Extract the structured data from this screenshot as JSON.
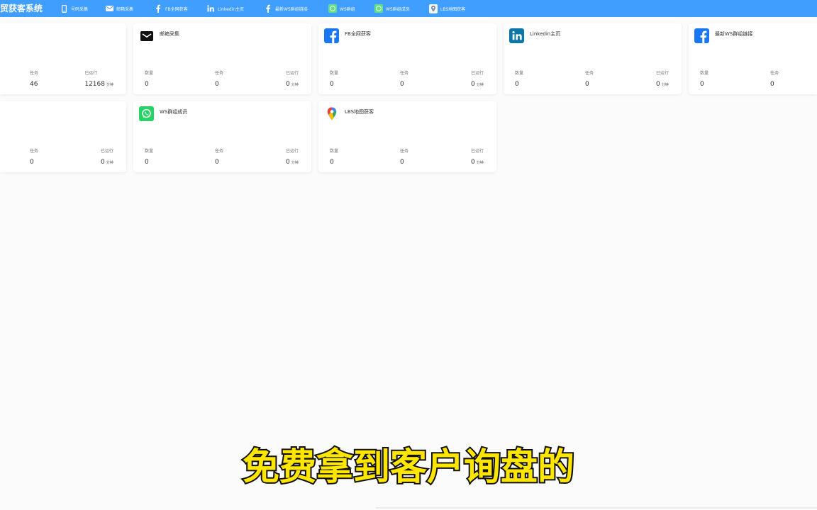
{
  "app": {
    "title": "贸获客系统"
  },
  "nav": {
    "items": [
      {
        "label": "号码采集",
        "icon": "phone-icon"
      },
      {
        "label": "邮箱采集",
        "icon": "envelope-icon"
      },
      {
        "label": "FB全网获客",
        "icon": "facebook-icon"
      },
      {
        "label": "Linkedin主页",
        "icon": "linkedin-icon"
      },
      {
        "label": "最新WS群组链接",
        "icon": "facebook-icon"
      },
      {
        "label": "WS群组",
        "icon": "whatsapp-icon"
      },
      {
        "label": "WS群组成员",
        "icon": "whatsapp-icon"
      },
      {
        "label": "LBS地图获客",
        "icon": "map-pin-icon"
      }
    ]
  },
  "cards": [
    {
      "stats": [
        {
          "label": "任务",
          "value": "46"
        },
        {
          "label": "已运行",
          "value": "12168",
          "unit": "分钟"
        }
      ]
    },
    {
      "title": "邮箱采集",
      "icon": "envelope-icon",
      "stats": [
        {
          "label": "数量",
          "value": "0"
        },
        {
          "label": "任务",
          "value": "0"
        },
        {
          "label": "已运行",
          "value": "0",
          "unit": "分钟"
        }
      ]
    },
    {
      "title": "FB全网获客",
      "icon": "facebook-icon",
      "stats": [
        {
          "label": "数量",
          "value": "0"
        },
        {
          "label": "任务",
          "value": "0"
        },
        {
          "label": "已运行",
          "value": "0",
          "unit": "分钟"
        }
      ]
    },
    {
      "title": "Linkedin主页",
      "icon": "linkedin-icon",
      "stats": [
        {
          "label": "数量",
          "value": "0"
        },
        {
          "label": "任务",
          "value": "0"
        },
        {
          "label": "已运行",
          "value": "0",
          "unit": "分钟"
        }
      ]
    },
    {
      "title": "最新WS群组链接",
      "icon": "facebook-icon",
      "stats": [
        {
          "label": "数量",
          "value": "0"
        },
        {
          "label": "任务",
          "value": "0"
        }
      ]
    },
    {
      "stats": [
        {
          "label": "任务",
          "value": "0"
        },
        {
          "label": "已运行",
          "value": "0",
          "unit": "分钟"
        }
      ]
    },
    {
      "title": "WS群组成员",
      "icon": "whatsapp-icon",
      "stats": [
        {
          "label": "数量",
          "value": "0"
        },
        {
          "label": "任务",
          "value": "0"
        },
        {
          "label": "已运行",
          "value": "0",
          "unit": "分钟"
        }
      ]
    },
    {
      "title": "LBS地图获客",
      "icon": "map-pin-icon",
      "stats": [
        {
          "label": "数量",
          "value": "0"
        },
        {
          "label": "任务",
          "value": "0"
        },
        {
          "label": "已运行",
          "value": "0",
          "unit": "分钟"
        }
      ]
    }
  ],
  "subtitle": "免费拿到客户询盘的",
  "colors": {
    "navbar": "#409eff",
    "facebook": "#1877f2",
    "linkedin": "#0a77a8",
    "whatsapp": "#25d366",
    "subtitle_fill": "#ffe600",
    "subtitle_stroke": "#111111"
  }
}
